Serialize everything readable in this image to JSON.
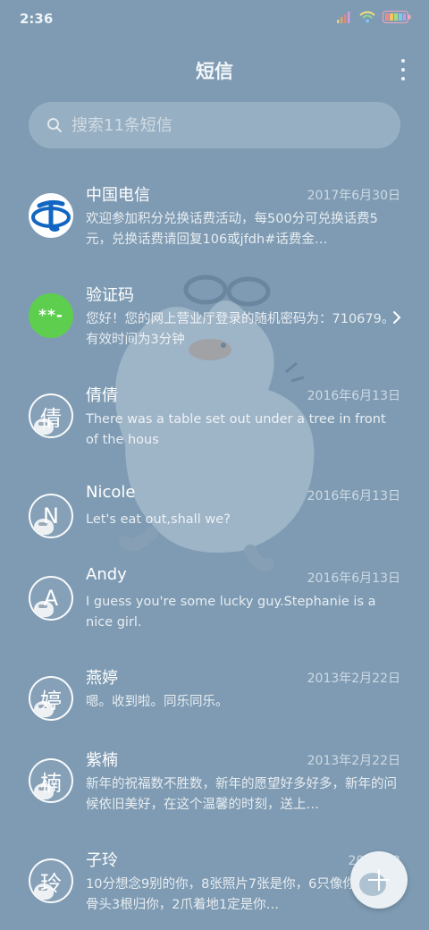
{
  "status": {
    "time": "2:36"
  },
  "header": {
    "title": "短信"
  },
  "search": {
    "placeholder": "搜索11条短信"
  },
  "conversations": [
    {
      "name": "中国电信",
      "date": "2017年6月30日",
      "preview": "欢迎参加积分兑换话费活动，每500分可兑换话费5元，兑换话费请回复106或jfdh#话费金…",
      "avatar": "telecom-logo"
    },
    {
      "name": "验证码",
      "date": "",
      "preview": "您好！您的网上营业厅登录的随机密码为：710679。有效时间为3分钟",
      "avatar_text": "**-"
    },
    {
      "name": "倩倩",
      "date": "2016年6月13日",
      "preview": "There was a table set out under a tree in front of the hous",
      "avatar_text": "倩"
    },
    {
      "name": "Nicole",
      "date": "2016年6月13日",
      "preview": "Let's eat out,shall we?",
      "avatar_text": "N"
    },
    {
      "name": "Andy",
      "date": "2016年6月13日",
      "preview": "I guess you're some lucky guy.Stephanie is a nice girl.",
      "avatar_text": "A"
    },
    {
      "name": "燕婷",
      "date": "2013年2月22日",
      "preview": "嗯。收到啦。同乐同乐。",
      "avatar_text": "婷"
    },
    {
      "name": "紫楠",
      "date": "2013年2月22日",
      "preview": "新年的祝福数不胜数，新年的愿望好多好多，新年的问候依旧美好，在这个温馨的时刻，送上…",
      "avatar_text": "楠"
    },
    {
      "name": "子玲",
      "date": "2013年2",
      "preview": "10分想念9别的你，8张照片7张是你，6只像你，4根骨头3根归你，2爪着地1定是你…",
      "avatar_text": "玲"
    }
  ],
  "colors": {
    "background": "#7e9bb3",
    "green_avatar": "#5ece4e",
    "telecom_blue": "#1266c2"
  }
}
